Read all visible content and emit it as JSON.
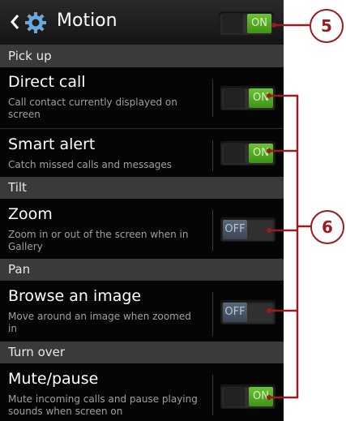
{
  "header": {
    "title": "Motion",
    "master_toggle": "ON"
  },
  "sections": {
    "pick_up": "Pick up",
    "tilt": "Tilt",
    "pan": "Pan",
    "turn_over": "Turn over"
  },
  "settings": {
    "direct_call": {
      "name": "Direct call",
      "desc": "Call contact currently displayed on screen",
      "state": "ON"
    },
    "smart_alert": {
      "name": "Smart alert",
      "desc": "Catch missed calls and messages",
      "state": "ON"
    },
    "zoom": {
      "name": "Zoom",
      "desc": "Zoom in or out of the screen when in Gallery",
      "state": "OFF"
    },
    "browse": {
      "name": "Browse an image",
      "desc": "Move around an image when zoomed in",
      "state": "OFF"
    },
    "mute": {
      "name": "Mute/pause",
      "desc": "Mute incoming calls and pause playing sounds when screen on",
      "state": "ON"
    }
  },
  "callouts": {
    "five": "5",
    "six": "6"
  },
  "colors": {
    "callout": "#9a1b20",
    "toggle_on": "#4fa821",
    "toggle_off": "#4a5766"
  },
  "icons": {
    "back": "chevron-left-icon",
    "settings": "gear-icon"
  }
}
